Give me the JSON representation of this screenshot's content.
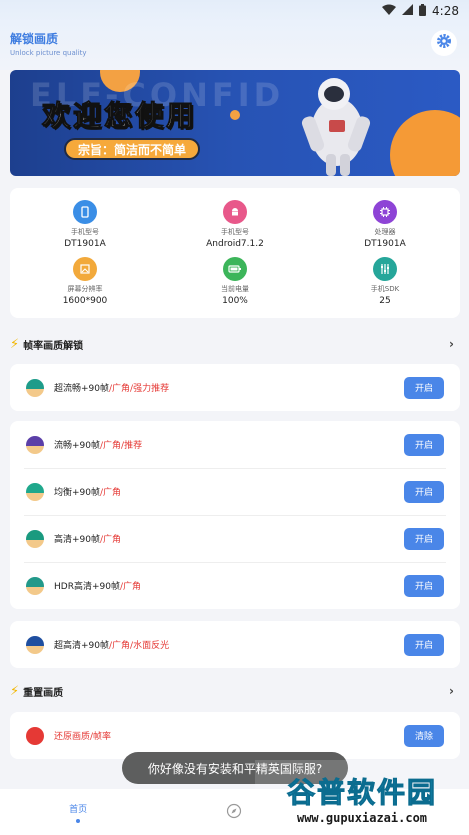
{
  "statusbar": {
    "time": "4:28"
  },
  "header": {
    "title": "解锁画质",
    "subtitle": "Unlock picture quality"
  },
  "banner": {
    "bg_text": "ELF-CONFID",
    "headline": "欢迎您使用",
    "slogan": "宗旨：简洁而不简单"
  },
  "device_info": [
    {
      "label": "手机型号",
      "value": "DT1901A",
      "icon": "phone-icon",
      "color": "#3a8ee6"
    },
    {
      "label": "手机型号",
      "value": "Android7.1.2",
      "icon": "android-icon",
      "color": "#e8588a"
    },
    {
      "label": "处理器",
      "value": "DT1901A",
      "icon": "chip-icon",
      "color": "#8e44d6"
    },
    {
      "label": "屏幕分辨率",
      "value": "1600*900",
      "icon": "image-icon",
      "color": "#f2a93b"
    },
    {
      "label": "当前电量",
      "value": "100%",
      "icon": "battery-icon",
      "color": "#3cb55a"
    },
    {
      "label": "手机SDK",
      "value": "25",
      "icon": "sliders-icon",
      "color": "#26a69a"
    }
  ],
  "sections": {
    "unlock": {
      "title": "帧率画质解锁"
    },
    "reset": {
      "title": "重置画质"
    }
  },
  "groups": [
    {
      "rows": [
        {
          "label": "超流畅+90帧",
          "tag": "/广角/强力推荐",
          "button": "开启",
          "color": "#1e9c8a"
        }
      ]
    },
    {
      "rows": [
        {
          "label": "流畅+90帧",
          "tag": "/广角/推荐",
          "button": "开启",
          "color": "#5b3fa8"
        },
        {
          "label": "均衡+90帧",
          "tag": "/广角",
          "button": "开启",
          "color": "#1fa88c"
        },
        {
          "label": "高清+90帧",
          "tag": "/广角",
          "button": "开启",
          "color": "#1a9a7f"
        },
        {
          "label": "HDR高清+90帧",
          "tag": "/广角",
          "button": "开启",
          "color": "#22998a"
        }
      ]
    },
    {
      "rows": [
        {
          "label": "超高清+90帧",
          "tag": "/广角/水面反光",
          "button": "开启",
          "color": "#1f4fa0"
        }
      ]
    }
  ],
  "reset_row": {
    "label": "还原画质/帧率",
    "button": "清除",
    "color": "#e53935"
  },
  "toast": "你好像没有安装和平精英国际服?",
  "bottom_nav": {
    "home": "首页"
  },
  "watermark": {
    "title": "谷普软件园",
    "url": "www.gupuxiazai.com"
  }
}
